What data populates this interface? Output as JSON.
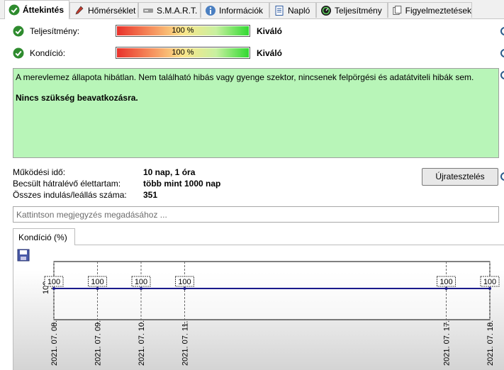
{
  "tabs": [
    {
      "label": "Áttekintés",
      "icon": "green-check-icon",
      "active": true
    },
    {
      "label": "Hőmérséklet",
      "icon": "thermometer-icon"
    },
    {
      "label": "S.M.A.R.T.",
      "icon": "drive-icon"
    },
    {
      "label": "Információk",
      "icon": "info-icon"
    },
    {
      "label": "Napló",
      "icon": "document-icon"
    },
    {
      "label": "Teljesítmény",
      "icon": "gauge-icon"
    },
    {
      "label": "Figyelmeztetések",
      "icon": "pages-icon"
    }
  ],
  "status": {
    "performance": {
      "label": "Teljesítmény:",
      "percent": "100 %",
      "value": 100,
      "rating": "Kiváló"
    },
    "condition": {
      "label": "Kondíció:",
      "percent": "100 %",
      "value": 100,
      "rating": "Kiváló"
    }
  },
  "message": {
    "line1": "A merevlemez állapota hibátlan. Nem található hibás vagy gyenge szektor, nincsenek felpörgési és adatátviteli hibák sem.",
    "line2": "Nincs szükség beavatkozásra."
  },
  "info": {
    "uptime_label": "Működési idő:",
    "uptime_value": "10 nap, 1 óra",
    "remaining_label": "Becsült hátralévő élettartam:",
    "remaining_value": "több mint 1000 nap",
    "starts_label": "Összes indulás/leállás száma:",
    "starts_value": "351"
  },
  "retest_label": "Újratesztelés",
  "comment_placeholder": "Kattintson megjegyzés megadásához ...",
  "graph_tab_label": "Kondíció  (%)",
  "colors": {
    "accent": "#1a1a8c",
    "good": "#b8f5b8",
    "check": "#2e8b2e"
  },
  "chart_data": {
    "type": "line",
    "ylabel": "",
    "y_tick": "100",
    "x": [
      "2021. 07. 08.",
      "2021. 07. 09.",
      "2021. 07. 10.",
      "2021. 07. 11.",
      "2021. 07. 17.",
      "2021. 07. 18."
    ],
    "values": [
      100,
      100,
      100,
      100,
      100,
      100
    ],
    "point_labels": [
      "100",
      "100",
      "100",
      "100",
      "100",
      "100"
    ]
  }
}
